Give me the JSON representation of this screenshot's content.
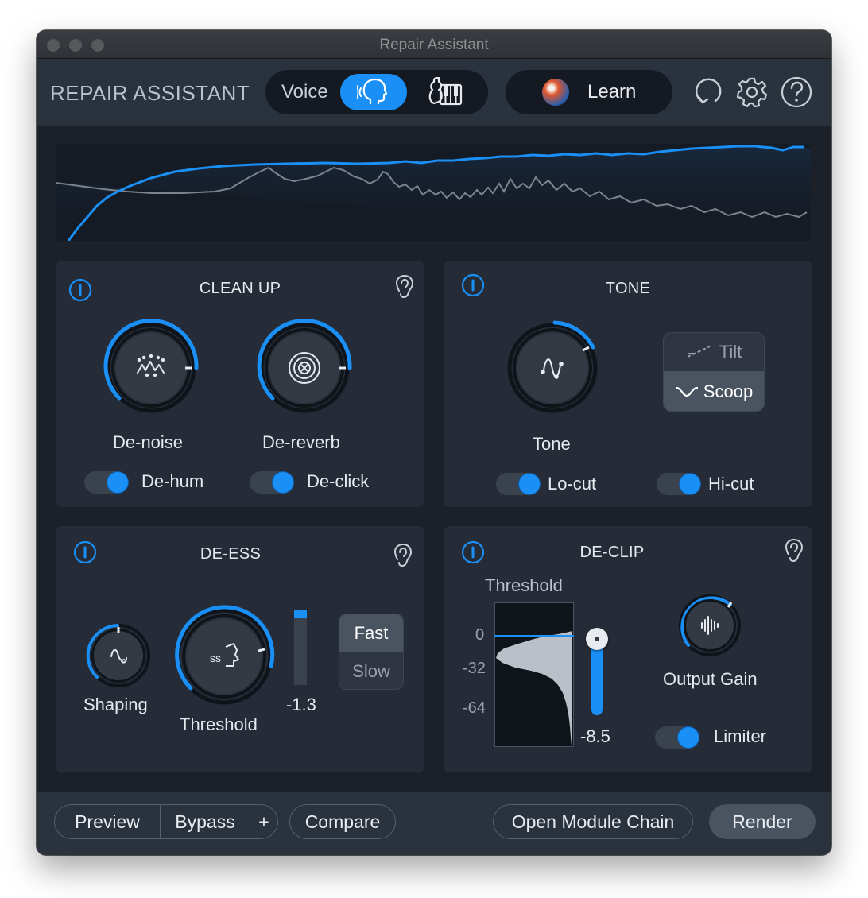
{
  "window": {
    "title": "Repair Assistant"
  },
  "header": {
    "brand": "REPAIR ASSISTANT",
    "mode": {
      "voice_label": "Voice",
      "selected": "voice"
    },
    "learn_label": "Learn",
    "accent": "#1a8ff5",
    "icons": [
      "undo-icon",
      "gear-icon",
      "help-icon"
    ]
  },
  "cleanup": {
    "title": "CLEAN UP",
    "denoise_label": "De-noise",
    "dereverb_label": "De-reverb",
    "dehum_label": "De-hum",
    "declick_label": "De-click",
    "dehum_on": true,
    "declick_on": true
  },
  "tone": {
    "title": "TONE",
    "knob_label": "Tone",
    "tilt_label": "Tilt",
    "scoop_label": "Scoop",
    "selected_mode": "Scoop",
    "locut_label": "Lo-cut",
    "hicut_label": "Hi-cut",
    "locut_on": true,
    "hicut_on": true
  },
  "deess": {
    "title": "DE-ESS",
    "shaping_label": "Shaping",
    "threshold_label": "Threshold",
    "meter_value": "-1.3",
    "fast_label": "Fast",
    "slow_label": "Slow",
    "selected_speed": "Fast"
  },
  "declip": {
    "title": "DE-CLIP",
    "threshold_label": "Threshold",
    "axis_ticks": [
      "0",
      "-32",
      "-64"
    ],
    "threshold_value": "-8.5",
    "output_gain_label": "Output Gain",
    "limiter_label": "Limiter",
    "limiter_on": true
  },
  "footer": {
    "preview_label": "Preview",
    "bypass_label": "Bypass",
    "plus_label": "+",
    "compare_label": "Compare",
    "open_chain_label": "Open Module Chain",
    "render_label": "Render"
  }
}
